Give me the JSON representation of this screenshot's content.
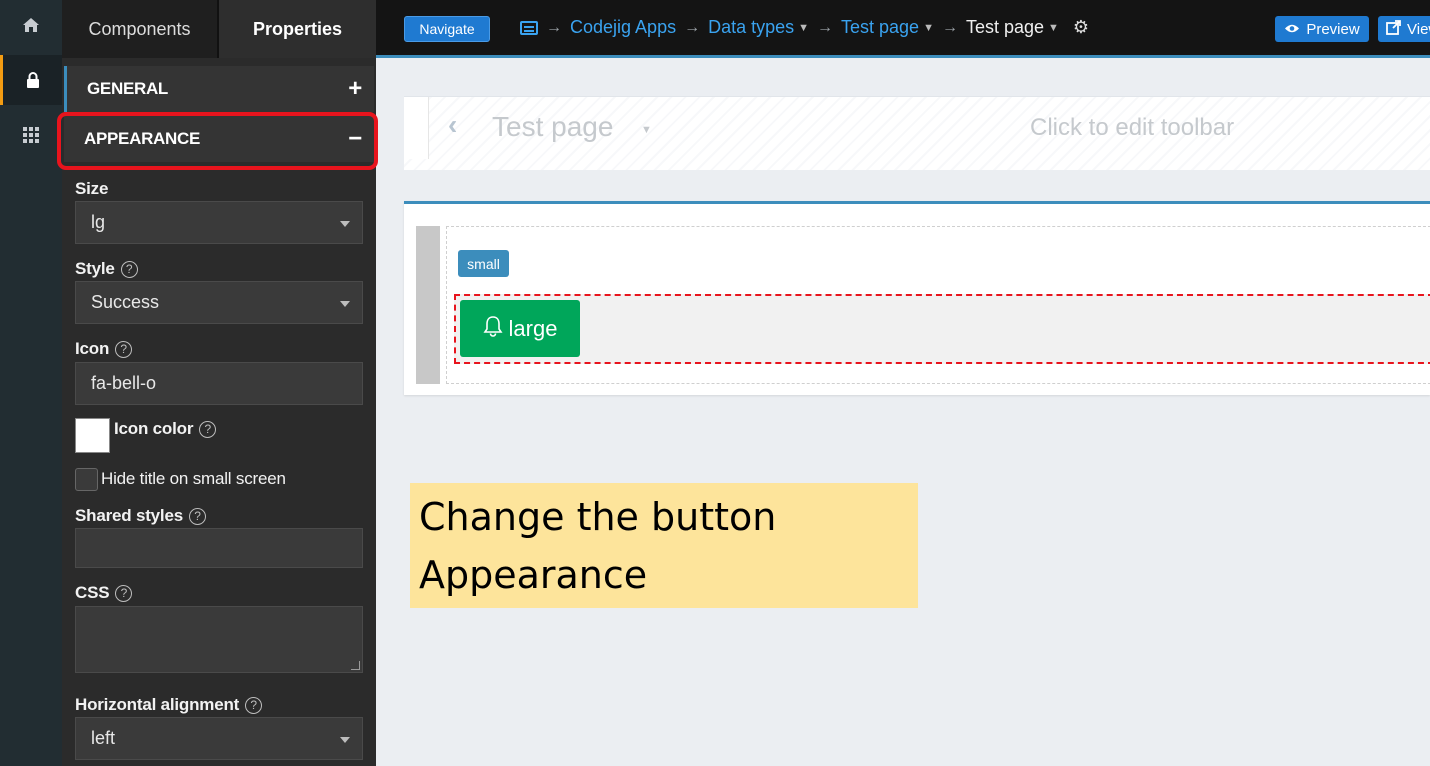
{
  "rail": {
    "items": [
      {
        "icon": "home-icon"
      },
      {
        "icon": "lock-icon",
        "active": true
      },
      {
        "icon": "grid-icon"
      }
    ]
  },
  "panel": {
    "tabs": [
      "Components",
      "Properties"
    ],
    "sections": {
      "general": {
        "label": "GENERAL",
        "sign": "+"
      },
      "appearance": {
        "label": "APPEARANCE",
        "sign": "−"
      }
    },
    "fields": {
      "size_label": "Size",
      "size_value": "lg",
      "style_label": "Style",
      "style_value": "Success",
      "icon_label": "Icon",
      "icon_value": "fa-bell-o",
      "icon_color_label": "Icon color",
      "icon_color_value": "#ffffff",
      "hide_title_label": "Hide title on small screen",
      "shared_styles_label": "Shared styles",
      "shared_styles_value": "",
      "css_label": "CSS",
      "css_value": "",
      "halign_label": "Horizontal alignment",
      "halign_value": "left"
    }
  },
  "topbar": {
    "navigate": "Navigate",
    "crumbs": [
      "Codejig Apps",
      "Data types",
      "Test page",
      "Test page"
    ],
    "preview": "Preview",
    "view": "View"
  },
  "canvas": {
    "toolbar_title": "Test page",
    "toolbar_hint": "Click to edit toolbar",
    "small_button": "small",
    "large_button": "large"
  },
  "note": {
    "line1": "Change the button",
    "line2": "Appearance"
  },
  "colors": {
    "accent": "#3c8dbc",
    "success": "#00a65a",
    "highlight": "#e8141d",
    "note_bg": "#fde49b"
  }
}
